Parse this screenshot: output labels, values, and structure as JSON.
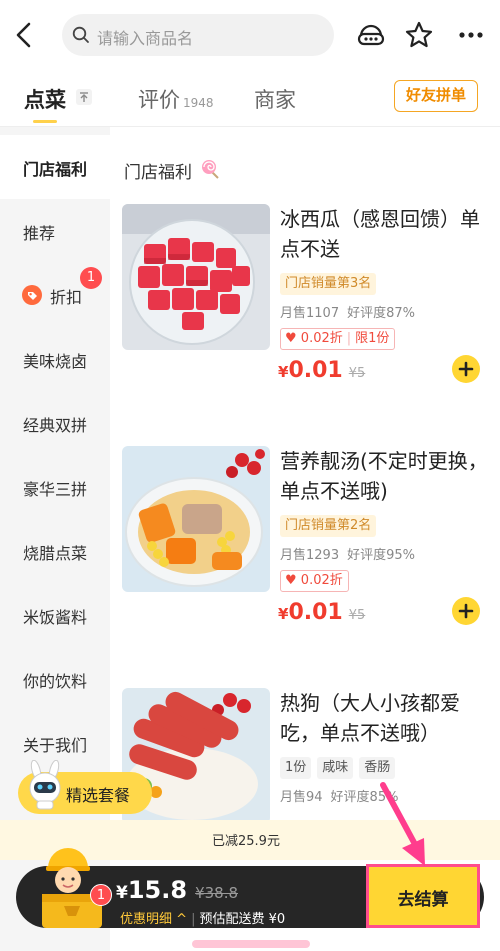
{
  "search": {
    "placeholder": "请输入商品名"
  },
  "tabs": [
    {
      "label": "点菜"
    },
    {
      "label": "评价",
      "count": "1948"
    },
    {
      "label": "商家"
    }
  ],
  "group_order_label": "好友拼单",
  "sidebar": {
    "items": [
      {
        "label": "门店福利"
      },
      {
        "label": "推荐"
      },
      {
        "label": "折扣",
        "badge": "1"
      },
      {
        "label": "美味烧卤"
      },
      {
        "label": "经典双拼"
      },
      {
        "label": "豪华三拼"
      },
      {
        "label": "烧腊点菜"
      },
      {
        "label": "米饭酱料"
      },
      {
        "label": "你的饮料"
      },
      {
        "label": "关于我们"
      }
    ]
  },
  "section": {
    "title": "门店福利"
  },
  "dishes": [
    {
      "name": "冰西瓜（感恩回馈）单点不送",
      "rank_tag": "门店销量第3名",
      "monthly_sales": "月售1107",
      "rating": "好评度87%",
      "promo": "0.02折",
      "limit": "限1份",
      "price_currency": "¥",
      "price": "0.01",
      "original_price": "¥5"
    },
    {
      "name": "营养靓汤(不定时更换，单点不送哦)",
      "rank_tag": "门店销量第2名",
      "monthly_sales": "月售1293",
      "rating": "好评度95%",
      "promo": "0.02折",
      "price_currency": "¥",
      "price": "0.01",
      "original_price": "¥5"
    },
    {
      "name": "热狗（大人小孩都爱吃，单点不送哦）",
      "tags": [
        "1份",
        "咸味",
        "香肠"
      ],
      "monthly_sales": "月售94",
      "rating": "好评度85%"
    }
  ],
  "combo_button": {
    "label": "精选套餐"
  },
  "discount_summary": "已减25.9元",
  "cart": {
    "badge": "1",
    "currency": "¥",
    "total": "15.8",
    "original_total": "¥38.8",
    "detail_label": "优惠明细",
    "delivery_fee": "预估配送费 ¥0",
    "checkout_label": "去结算"
  },
  "colors": {
    "accent_yellow": "#ffd633",
    "price_red": "#f03c2e",
    "highlight_pink": "#ff4d8d"
  }
}
